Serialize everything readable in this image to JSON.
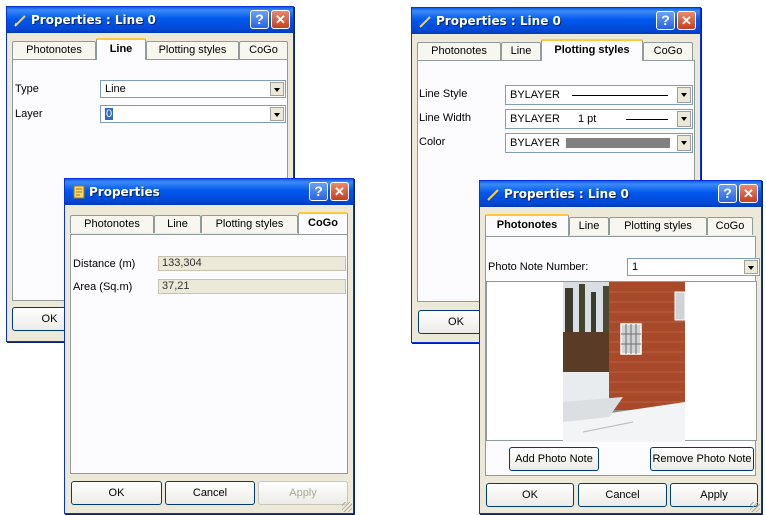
{
  "win1": {
    "title": "Properties : Line 0",
    "tabs": [
      "Photonotes",
      "Line",
      "Plotting styles",
      "CoGo"
    ],
    "type_label": "Type",
    "type_value": "Line",
    "layer_label": "Layer",
    "layer_value": "0",
    "ok_label": "OK"
  },
  "win2": {
    "title": "Properties",
    "tabs": [
      "Photonotes",
      "Line",
      "Plotting styles",
      "CoGo"
    ],
    "distance_label": "Distance (m)",
    "distance_value": "133,304",
    "area_label": "Area (Sq.m)",
    "area_value": "37,21",
    "ok_label": "OK",
    "cancel_label": "Cancel",
    "apply_label": "Apply"
  },
  "win3": {
    "title": "Properties : Line 0",
    "tabs": [
      "Photonotes",
      "Line",
      "Plotting styles",
      "CoGo"
    ],
    "line_style_label": "Line Style",
    "line_style_value": "BYLAYER",
    "line_width_label": "Line Width",
    "line_width_value": "BYLAYER",
    "line_width_pt": "1 pt",
    "color_label": "Color",
    "color_value": "BYLAYER",
    "ok_label": "OK"
  },
  "win4": {
    "title": "Properties : Line 0",
    "tabs": [
      "Photonotes",
      "Line",
      "Plotting styles",
      "CoGo"
    ],
    "photo_note_label": "Photo Note Number:",
    "photo_note_value": "1",
    "add_label": "Add Photo Note",
    "remove_label": "Remove Photo Note",
    "ok_label": "OK",
    "cancel_label": "Cancel",
    "apply_label": "Apply"
  },
  "colors": {
    "titlebar": "#0058ee",
    "dialog_bg": "#ece9d8",
    "color_swatch": "#808080"
  },
  "icons": {
    "title_icon": "pencil-icon",
    "title_icon_win2": "note-icon",
    "help": "help-icon",
    "close": "close-icon",
    "dropdown": "chevron-down-icon"
  }
}
